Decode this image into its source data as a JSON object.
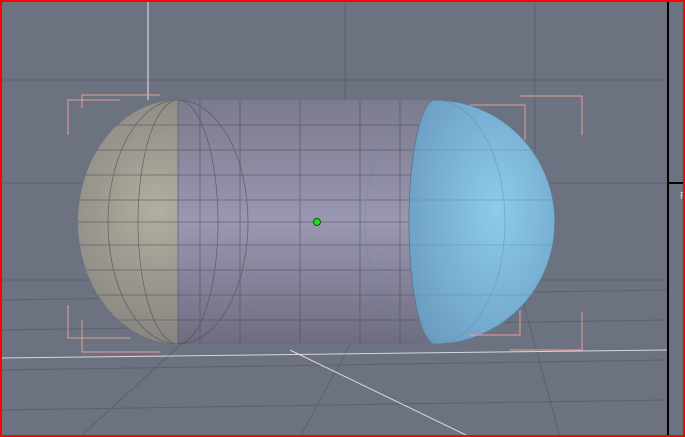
{
  "viewport": {
    "side_panel_label": "F",
    "colors": {
      "background": "#6c7280",
      "border": "#ff0000",
      "grid": "#5a606c",
      "capsule_body": "#8a8a9e",
      "capsule_cap_left": "#a8a690",
      "capsule_cap_right": "#86c4e4",
      "pivot": "#22dd22",
      "selection_brackets": "#e89a9a"
    }
  }
}
